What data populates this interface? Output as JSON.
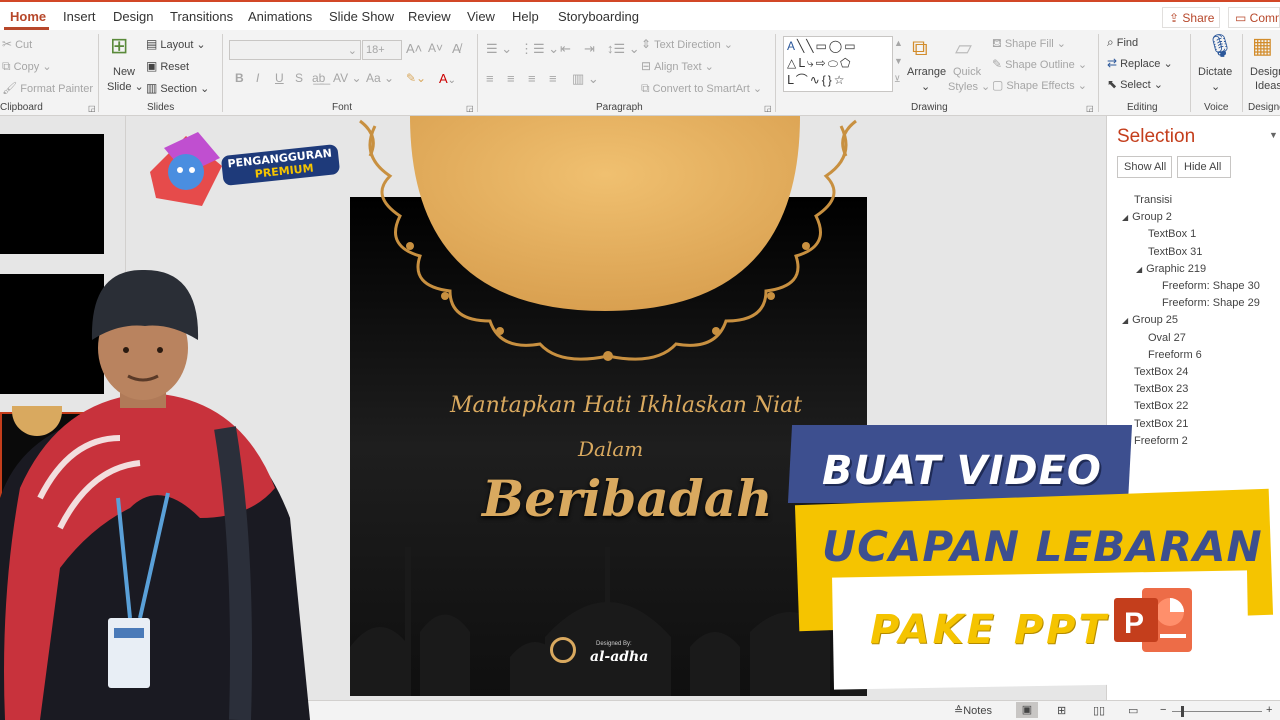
{
  "tabs": [
    "Home",
    "Insert",
    "Design",
    "Transitions",
    "Animations",
    "Slide Show",
    "Review",
    "View",
    "Help",
    "Storyboarding"
  ],
  "share_label": "Share",
  "comments_label": "Comm",
  "ribbon": {
    "clipboard": {
      "cut": "Cut",
      "copy": "Copy",
      "format_painter": "Format Painter",
      "label": "Clipboard"
    },
    "slides": {
      "new_slide_1": "New",
      "new_slide_2": "Slide",
      "layout": "Layout",
      "reset": "Reset",
      "section": "Section",
      "label": "Slides"
    },
    "font": {
      "size": "18+",
      "label": "Font",
      "bold": "B",
      "italic": "I",
      "underline": "U",
      "strike": "S"
    },
    "paragraph": {
      "text_direction": "Text Direction",
      "align_text": "Align Text",
      "convert_smartart": "Convert to SmartArt",
      "label": "Paragraph"
    },
    "drawing": {
      "arrange": "Arrange",
      "quick_styles_1": "Quick",
      "quick_styles_2": "Styles",
      "shape_fill": "Shape Fill",
      "shape_outline": "Shape Outline",
      "shape_effects": "Shape Effects",
      "label": "Drawing"
    },
    "editing": {
      "find": "Find",
      "replace": "Replace",
      "select": "Select",
      "label": "Editing"
    },
    "voice": {
      "dictate": "Dictate",
      "label": "Voice"
    },
    "designer": {
      "design_ideas_1": "Design",
      "design_ideas_2": "Ideas",
      "label": "Designer"
    }
  },
  "selection_pane": {
    "title": "Selection",
    "show_all": "Show All",
    "hide_all": "Hide All",
    "items": [
      {
        "label": "Transisi",
        "indent": 0,
        "expand": false
      },
      {
        "label": "Group 2",
        "indent": 0,
        "expand": true
      },
      {
        "label": "TextBox 1",
        "indent": 1,
        "expand": false
      },
      {
        "label": "TextBox 31",
        "indent": 1,
        "expand": false
      },
      {
        "label": "Graphic 219",
        "indent": 1,
        "expand": true
      },
      {
        "label": "Freeform: Shape 30",
        "indent": 2,
        "expand": false
      },
      {
        "label": "Freeform: Shape 29",
        "indent": 2,
        "expand": false
      },
      {
        "label": "Group 25",
        "indent": 0,
        "expand": true
      },
      {
        "label": "Oval 27",
        "indent": 1,
        "expand": false
      },
      {
        "label": "Freeform 6",
        "indent": 1,
        "expand": false
      },
      {
        "label": "TextBox 24",
        "indent": 0,
        "expand": false
      },
      {
        "label": "TextBox 23",
        "indent": 0,
        "expand": false
      },
      {
        "label": "TextBox 22",
        "indent": 0,
        "expand": false
      },
      {
        "label": "TextBox 21",
        "indent": 0,
        "expand": false
      },
      {
        "label": "Freeform 2",
        "indent": 0,
        "expand": false
      }
    ]
  },
  "slide": {
    "line1": "Mantapkan Hati  Ikhlaskan Niat",
    "line2": "Dalam",
    "title": "Beribadah",
    "designed_by": "Designed By:",
    "brand": "al-adha"
  },
  "badge": {
    "line1": "PENGANGGURAN",
    "line2": "PREMIUM"
  },
  "banners": {
    "line1": "BUAT VIDEO",
    "line2": "UCAPAN LEBARAN",
    "line3": "PAKE PPT"
  },
  "statusbar": {
    "notes": "Notes"
  },
  "colors": {
    "accent": "#b7472a",
    "gold": "#d9a95f",
    "banner_blue": "#3d4f8f",
    "banner_yellow": "#f5c400"
  }
}
